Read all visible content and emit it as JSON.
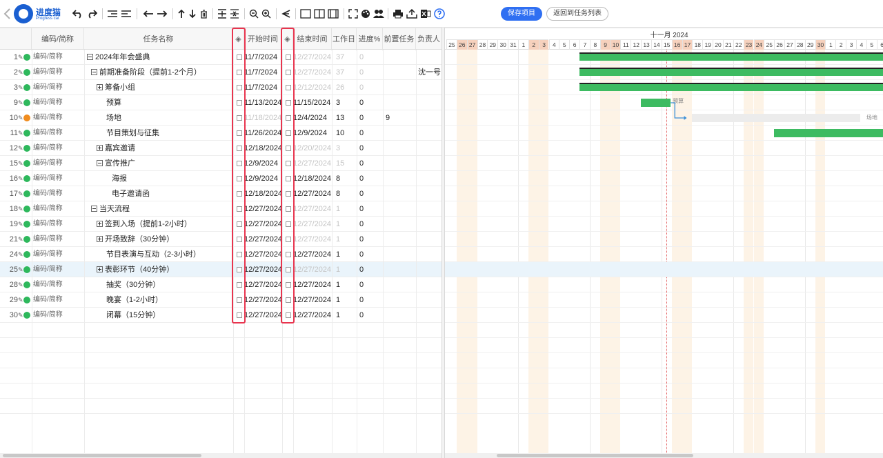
{
  "logo": {
    "name": "进度猫",
    "subtitle": "Progress cat"
  },
  "toolbar": {
    "save_label": "保存项目",
    "back_label": "返回到任务列表"
  },
  "columns": {
    "code": "编码/简称",
    "name": "任务名称",
    "start": "开始时间",
    "end": "结束时间",
    "work": "工作日",
    "progress": "进度%",
    "pred": "前置任务",
    "owner": "负责人"
  },
  "rows": [
    {
      "num": "1",
      "code": "编码/简称",
      "name": "2024年年会盛典",
      "toggle": "minus",
      "indent": 0,
      "start": "11/7/2024",
      "end": "12/27/2024",
      "work": "37",
      "progress": "0",
      "pred": "",
      "owner": "",
      "dot": "green",
      "startDim": false,
      "endDim": true
    },
    {
      "num": "2",
      "code": "编码/简称",
      "name": "前期准备阶段（提前1-2个月）",
      "toggle": "minus",
      "indent": 1,
      "start": "11/7/2024",
      "end": "12/27/2024",
      "work": "37",
      "progress": "0",
      "pred": "",
      "owner": "沈一号",
      "dot": "green",
      "startDim": false,
      "endDim": true
    },
    {
      "num": "3",
      "code": "编码/简称",
      "name": "筹备小组",
      "toggle": "plus",
      "indent": 2,
      "start": "11/7/2024",
      "end": "12/12/2024",
      "work": "26",
      "progress": "0",
      "pred": "",
      "owner": "",
      "dot": "green",
      "startDim": false,
      "endDim": true
    },
    {
      "num": "9",
      "code": "编码/简称",
      "name": "预算",
      "toggle": "",
      "indent": 3,
      "start": "11/13/2024",
      "end": "11/15/2024",
      "work": "3",
      "progress": "0",
      "pred": "",
      "owner": "",
      "dot": "green",
      "startDim": false,
      "endDim": false
    },
    {
      "num": "10",
      "code": "编码/简称",
      "name": "场地",
      "toggle": "",
      "indent": 3,
      "start": "11/18/2024",
      "end": "12/4/2024",
      "work": "13",
      "progress": "0",
      "pred": "9",
      "owner": "",
      "dot": "orange",
      "startDim": true,
      "endDim": false
    },
    {
      "num": "11",
      "code": "编码/简称",
      "name": "节目策划与征集",
      "toggle": "",
      "indent": 3,
      "start": "11/26/2024",
      "end": "12/9/2024",
      "work": "10",
      "progress": "0",
      "pred": "",
      "owner": "",
      "dot": "green",
      "startDim": false,
      "endDim": false
    },
    {
      "num": "12",
      "code": "编码/简称",
      "name": "嘉宾邀请",
      "toggle": "plus",
      "indent": 2,
      "start": "12/18/2024",
      "end": "12/20/2024",
      "work": "3",
      "progress": "0",
      "pred": "",
      "owner": "",
      "dot": "green",
      "startDim": false,
      "endDim": true
    },
    {
      "num": "15",
      "code": "编码/简称",
      "name": "宣传推广",
      "toggle": "minus",
      "indent": 2,
      "start": "12/9/2024",
      "end": "12/27/2024",
      "work": "15",
      "progress": "0",
      "pred": "",
      "owner": "",
      "dot": "green",
      "startDim": false,
      "endDim": true
    },
    {
      "num": "16",
      "code": "编码/简称",
      "name": "海报",
      "toggle": "",
      "indent": 4,
      "start": "12/9/2024",
      "end": "12/18/2024",
      "work": "8",
      "progress": "0",
      "pred": "",
      "owner": "",
      "dot": "green",
      "startDim": false,
      "endDim": false
    },
    {
      "num": "17",
      "code": "编码/简称",
      "name": "电子邀请函",
      "toggle": "",
      "indent": 4,
      "start": "12/18/2024",
      "end": "12/27/2024",
      "work": "8",
      "progress": "0",
      "pred": "",
      "owner": "",
      "dot": "green",
      "startDim": false,
      "endDim": false
    },
    {
      "num": "18",
      "code": "编码/简称",
      "name": "当天流程",
      "toggle": "minus",
      "indent": 1,
      "start": "12/27/2024",
      "end": "12/27/2024",
      "work": "1",
      "progress": "0",
      "pred": "",
      "owner": "",
      "dot": "green",
      "startDim": false,
      "endDim": true
    },
    {
      "num": "19",
      "code": "编码/简称",
      "name": "签到入场（提前1-2小时）",
      "toggle": "plus",
      "indent": 2,
      "start": "12/27/2024",
      "end": "12/27/2024",
      "work": "1",
      "progress": "0",
      "pred": "",
      "owner": "",
      "dot": "green",
      "startDim": false,
      "endDim": true
    },
    {
      "num": "21",
      "code": "编码/简称",
      "name": "开场致辞（30分钟）",
      "toggle": "plus",
      "indent": 2,
      "start": "12/27/2024",
      "end": "12/27/2024",
      "work": "1",
      "progress": "0",
      "pred": "",
      "owner": "",
      "dot": "green",
      "startDim": false,
      "endDim": true
    },
    {
      "num": "24",
      "code": "编码/简称",
      "name": "节目表演与互动（2-3小时）",
      "toggle": "",
      "indent": 3,
      "start": "12/27/2024",
      "end": "12/27/2024",
      "work": "1",
      "progress": "0",
      "pred": "",
      "owner": "",
      "dot": "green",
      "startDim": false,
      "endDim": false
    },
    {
      "num": "25",
      "code": "编码/简称",
      "name": "表彰环节（40分钟）",
      "toggle": "plus",
      "indent": 2,
      "start": "12/27/2024",
      "end": "12/27/2024",
      "work": "1",
      "progress": "0",
      "pred": "",
      "owner": "",
      "dot": "green",
      "startDim": false,
      "endDim": true,
      "highlight": true
    },
    {
      "num": "28",
      "code": "编码/简称",
      "name": "抽奖（30分钟）",
      "toggle": "",
      "indent": 3,
      "start": "12/27/2024",
      "end": "12/27/2024",
      "work": "1",
      "progress": "0",
      "pred": "",
      "owner": "",
      "dot": "green",
      "startDim": false,
      "endDim": false
    },
    {
      "num": "29",
      "code": "编码/简称",
      "name": "晚宴（1-2小时）",
      "toggle": "",
      "indent": 3,
      "start": "12/27/2024",
      "end": "12/27/2024",
      "work": "1",
      "progress": "0",
      "pred": "",
      "owner": "",
      "dot": "green",
      "startDim": false,
      "endDim": false
    },
    {
      "num": "30",
      "code": "编码/简称",
      "name": "闭幕（15分钟）",
      "toggle": "",
      "indent": 3,
      "start": "12/27/2024",
      "end": "12/27/2024",
      "work": "1",
      "progress": "0",
      "pred": "",
      "owner": "",
      "dot": "green",
      "startDim": false,
      "endDim": false
    }
  ],
  "gantt": {
    "month_label": "十一月 2024",
    "days": [
      "25",
      "26",
      "27",
      "28",
      "29",
      "30",
      "31",
      "1",
      "2",
      "3",
      "4",
      "5",
      "6",
      "7",
      "8",
      "9",
      "10",
      "11",
      "12",
      "13",
      "14",
      "15",
      "16",
      "17",
      "18",
      "19",
      "20",
      "21",
      "22",
      "23",
      "24",
      "25",
      "26",
      "27",
      "28",
      "29",
      "30",
      "1",
      "2",
      "3",
      "4",
      "5",
      "6"
    ],
    "weekend_days": [
      1,
      2,
      8,
      9,
      15,
      16,
      22,
      23,
      29,
      30,
      36
    ],
    "bar_labels": {
      "budget": "预算",
      "venue": "场地"
    }
  },
  "colors": {
    "accent": "#2f6ff2",
    "bar": "#3dbb61",
    "highlight_box": "#e8344e",
    "weekend": "#f6d1bd"
  }
}
